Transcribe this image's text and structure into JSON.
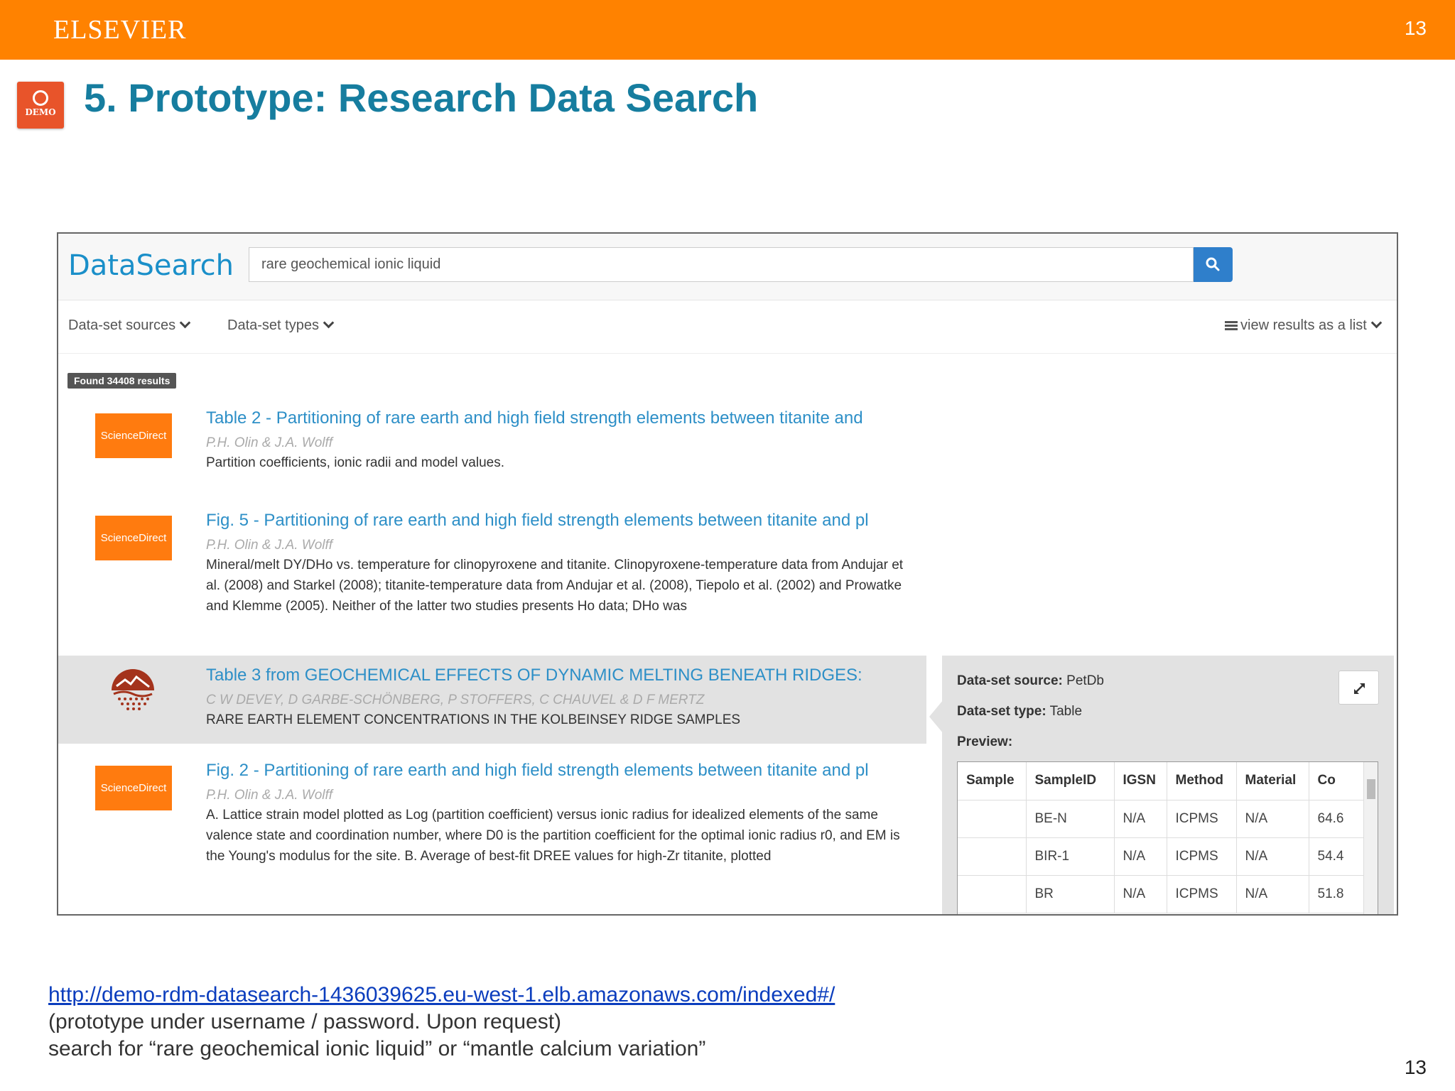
{
  "slide": {
    "publisher": "ELSEVIER",
    "page_number": "13",
    "demo_badge": "DEMO",
    "title": "5. Prototype: Research Data Search"
  },
  "app": {
    "logo": "DataSearch",
    "search_value": "rare geochemical ionic liquid",
    "filters": {
      "sources": "Data-set sources",
      "types": "Data-set types",
      "view": "view results as a list"
    },
    "found": "Found 34408 results",
    "results": [
      {
        "source_logo": "ScienceDirect",
        "title": "Table 2 - Partitioning of rare earth and high field strength elements between titanite and",
        "authors": "P.H. Olin & J.A. Wolff",
        "description": "Partition coefficients, ionic radii and model values."
      },
      {
        "source_logo": "ScienceDirect",
        "title": "Fig. 5 - Partitioning of rare earth and high field strength elements between titanite and pl",
        "authors": "P.H. Olin & J.A. Wolff",
        "description": "Mineral/melt DY/DHo vs. temperature for clinopyroxene and titanite. Clinopyroxene-temperature data from Andujar et al. (2008) and Starkel (2008); titanite-temperature data from Andujar et al. (2008), Tiepolo et al. (2002) and Prowatke and Klemme (2005). Neither of the latter two studies presents Ho data; DHo was"
      },
      {
        "source_logo": "PetDb",
        "title": "Table 3 from GEOCHEMICAL EFFECTS OF DYNAMIC MELTING BENEATH RIDGES:",
        "authors": "C W DEVEY, D GARBE-SCHÖNBERG, P STOFFERS, C CHAUVEL & D F MERTZ",
        "description": "RARE EARTH ELEMENT CONCENTRATIONS IN THE KOLBEINSEY RIDGE SAMPLES"
      },
      {
        "source_logo": "ScienceDirect",
        "title": "Fig. 2 - Partitioning of rare earth and high field strength elements between titanite and pl",
        "authors": "P.H. Olin & J.A. Wolff",
        "description": "A. Lattice strain model plotted as Log (partition coefficient) versus ionic radius for idealized elements of the same valence state and coordination number, where D0 is the partition coefficient for the optimal ionic radius r0, and EM is the Young's modulus for the site. B. Average of best-fit DREE values for high-Zr titanite, plotted"
      }
    ],
    "preview": {
      "source_label": "Data-set source:",
      "source_value": "PetDb",
      "type_label": "Data-set type:",
      "type_value": "Table",
      "preview_label": "Preview:",
      "columns": [
        "Sample",
        "SampleID",
        "IGSN",
        "Method",
        "Material",
        "Co"
      ],
      "rows": [
        [
          "",
          "BE-N",
          "N/A",
          "ICPMS",
          "N/A",
          "64.6"
        ],
        [
          "",
          "BIR-1",
          "N/A",
          "ICPMS",
          "N/A",
          "54.4"
        ],
        [
          "",
          "BR",
          "N/A",
          "ICPMS",
          "N/A",
          "51.8"
        ]
      ]
    }
  },
  "footer": {
    "link": "http://demo-rdm-datasearch-1436039625.eu-west-1.elb.amazonaws.com/indexed#/",
    "line2": "(prototype under username / password. Upon request)",
    "line3": "search for “rare geochemical ionic liquid” or “mantle calcium variation”"
  }
}
